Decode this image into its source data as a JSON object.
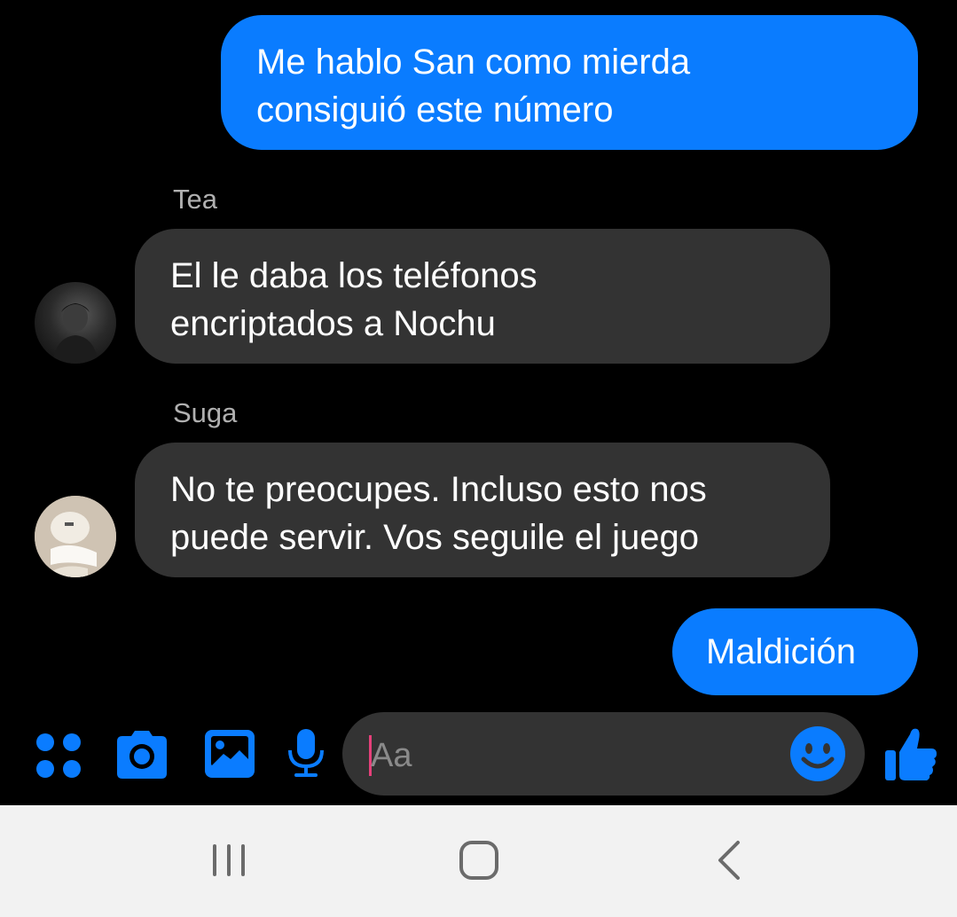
{
  "messages": [
    {
      "id": "msg1",
      "direction": "outgoing",
      "text": "Me hablo San como mierda\nconsiguió este número"
    },
    {
      "id": "msg2",
      "direction": "incoming",
      "sender": "Tea",
      "text": "El le daba los teléfonos\nencriptados a Nochu"
    },
    {
      "id": "msg3",
      "direction": "incoming",
      "sender": "Suga",
      "text": "No te preocupes. Incluso esto nos\npuede servir. Vos seguile el juego"
    },
    {
      "id": "msg4",
      "direction": "outgoing",
      "text": "Maldición"
    }
  ],
  "composer": {
    "placeholder": "Aa",
    "icons": [
      "apps-icon",
      "camera-icon",
      "gallery-icon",
      "mic-icon",
      "emoji-icon",
      "like-icon"
    ]
  },
  "navigation": {
    "icons": [
      "recents-icon",
      "home-icon",
      "back-icon"
    ]
  },
  "colors": {
    "background": "#000000",
    "outgoing_bubble": "#0a7cff",
    "incoming_bubble": "#333333",
    "accent": "#0a7cff",
    "sender_name": "#b0b0b0",
    "nav_bar": "#f2f2f2"
  }
}
